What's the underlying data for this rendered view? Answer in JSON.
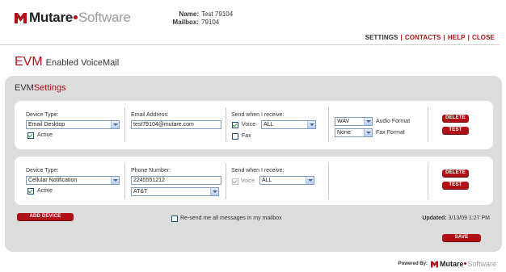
{
  "header": {
    "brand": "Mutare",
    "brand_suffix": "Software",
    "name_label": "Name:",
    "name_value": "Test 79104",
    "mailbox_label": "Mailbox:",
    "mailbox_value": "79104"
  },
  "nav": {
    "settings": "SETTINGS",
    "contacts": "CONTACTS",
    "help": "HELP",
    "close": "CLOSE",
    "separator": "|"
  },
  "page": {
    "title_main": "EVM",
    "title_sub": "Enabled VoiceMail",
    "panel_title_a": "EVM",
    "panel_title_b": "Settings"
  },
  "devices": [
    {
      "device_type_label": "Device Type:",
      "device_type": "Email Desktop",
      "active_label": "Active",
      "active": true,
      "address_label": "Email Address:",
      "address": "test79104@mutare.com",
      "receive_label": "When I receive:",
      "receive_prefix": "Send when I receive:",
      "voice_label": "Voice",
      "voice_checked": true,
      "voice_option": "ALL",
      "fax_label": "Fax",
      "fax_checked": false,
      "audio_format": "WAV",
      "audio_format_label": "Audio Format",
      "fax_format": "None",
      "fax_format_label": "Fax Format",
      "delete_label": "DELETE",
      "test_label": "TEST"
    },
    {
      "device_type_label": "Device Type:",
      "device_type": "Cellular Notification",
      "active_label": "Active",
      "active": true,
      "address_label": "Phone Number:",
      "address": "2245551212",
      "carrier": "AT&T",
      "receive_prefix": "Send when I receive:",
      "voice_label": "Voice",
      "voice_checked": true,
      "voice_option": "ALL",
      "delete_label": "DELETE",
      "test_label": "TEST"
    }
  ],
  "footer": {
    "add_device": "ADD DEVICE",
    "resend_label": "Re-send me all messages in my mailbox",
    "updated_label": "Updated:",
    "updated_value": "3/13/09 1:27 PM",
    "save": "SAVE",
    "powered_by": "Powered By:"
  },
  "colors": {
    "accent": "#b01116",
    "panel_bg": "#dcdcdc"
  }
}
